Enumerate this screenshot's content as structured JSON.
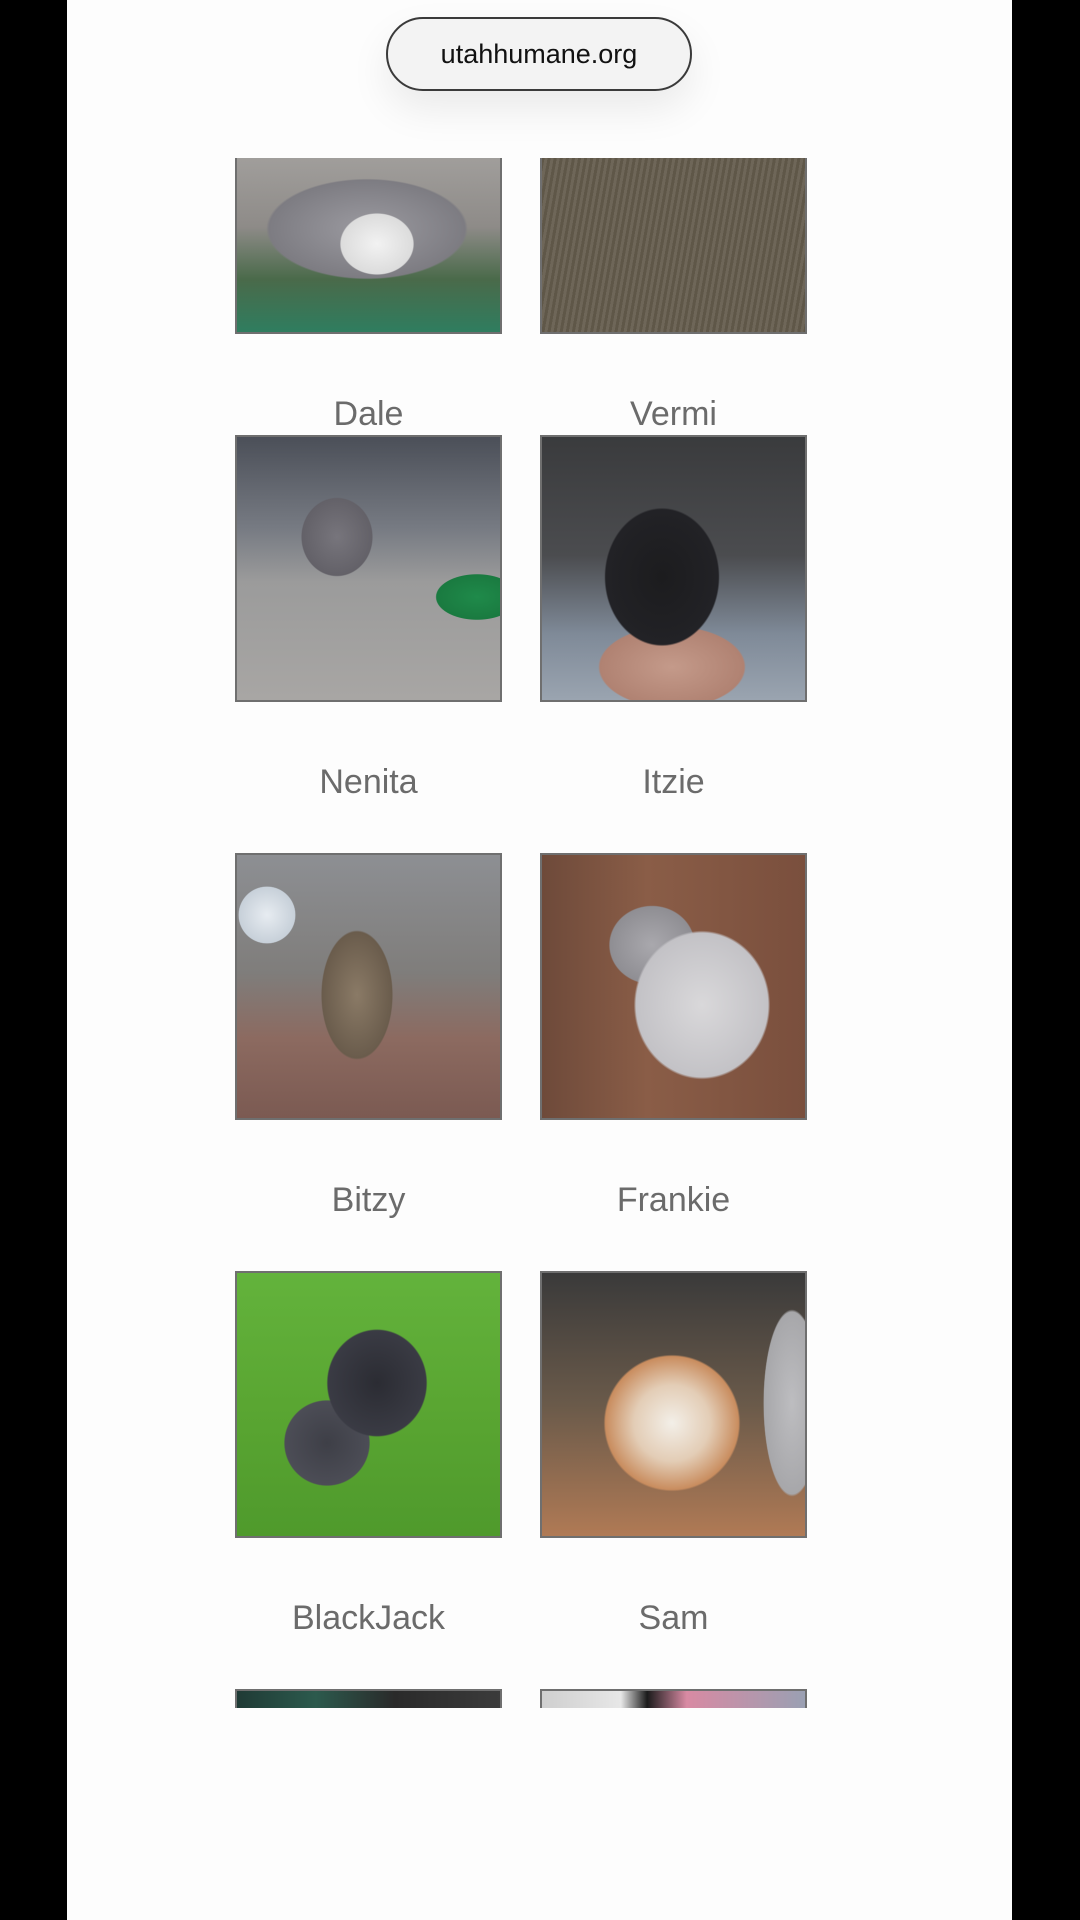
{
  "browser": {
    "url": "utahhumane.org"
  },
  "pets": [
    {
      "name": "Dale"
    },
    {
      "name": "Vermi"
    },
    {
      "name": "Nenita"
    },
    {
      "name": "Itzie"
    },
    {
      "name": "Bitzy"
    },
    {
      "name": "Frankie"
    },
    {
      "name": "BlackJack"
    },
    {
      "name": "Sam"
    }
  ]
}
